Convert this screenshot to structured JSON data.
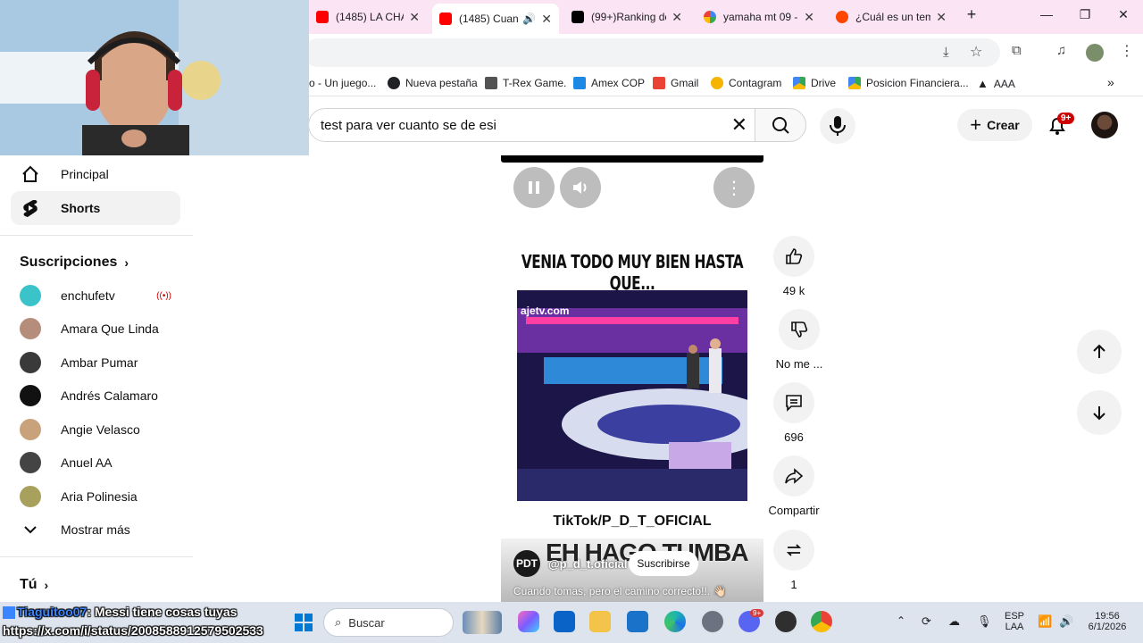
{
  "browser": {
    "tabs": [
      {
        "title": "(1485) LA CHAR",
        "active": false
      },
      {
        "title": "(1485) Cuan",
        "active": true
      },
      {
        "title": "(99+)Ranking de",
        "active": false
      },
      {
        "title": "yamaha mt 09 -",
        "active": false
      },
      {
        "title": "¿Cuál es un tem",
        "active": false
      }
    ],
    "new_tab": "+",
    "bookmarks": [
      {
        "label": "o - Un juego...",
        "color": "#3c7a3c"
      },
      {
        "label": "Nueva pestaña",
        "color": "#202124"
      },
      {
        "label": "T-Rex Game.",
        "color": "#535353"
      },
      {
        "label": "Amex COP",
        "color": "#1e88e5"
      },
      {
        "label": "Gmail",
        "color": "#ea4335"
      },
      {
        "label": "Contagram",
        "color": "#f4b400"
      },
      {
        "label": "Drive",
        "color": "#34a853"
      },
      {
        "label": "Posicion Financiera...",
        "color": "#34a853"
      },
      {
        "label": "AAA",
        "color": "#202124"
      }
    ],
    "more_bookmarks": "»"
  },
  "youtube": {
    "search_query": "test para ver cuanto se de esi",
    "create_label": "Crear",
    "notif_badge": "9+"
  },
  "sidebar": {
    "top_items": [
      {
        "label": "Principal",
        "icon": "home-icon",
        "selected": false
      },
      {
        "label": "Shorts",
        "icon": "shorts-icon",
        "selected": true
      }
    ],
    "subscriptions_heading": "Suscripciones",
    "subscriptions": [
      {
        "label": "enchufetv",
        "color": "#3ac3c9",
        "live": true
      },
      {
        "label": "Amara Que Linda",
        "color": "#b58d7a",
        "live": false
      },
      {
        "label": "Ambar Pumar",
        "color": "#3a3a3a",
        "live": false
      },
      {
        "label": "Andrés Calamaro",
        "color": "#111111",
        "live": false
      },
      {
        "label": "Angie Velasco",
        "color": "#c9a27c",
        "live": false
      },
      {
        "label": "Anuel AA",
        "color": "#444444",
        "live": false
      },
      {
        "label": "Aria Polinesia",
        "color": "#a8a15e",
        "live": false
      }
    ],
    "show_more": "Mostrar más",
    "you_heading": "Tú"
  },
  "short": {
    "title": "VENIA TODO MUY BIEN HASTA QUE...",
    "watermark": "ajetv.com",
    "credit": "TikTok/P_D_T_OFICIAL",
    "big_caption": "EH HAGO TUMBA",
    "channel_avatar": "PDT",
    "channel_name": "@p_d_t.oficial",
    "subscribe_label": "Suscribirse",
    "caption": "Cuando tomas, pero el camino correcto!!. 👋🏻",
    "actions": [
      {
        "name": "like",
        "icon": "thumbs-up-icon",
        "label": "49 k"
      },
      {
        "name": "dislike",
        "icon": "thumbs-down-icon",
        "label": "No me ..."
      },
      {
        "name": "comments",
        "icon": "comment-icon",
        "label": "696"
      },
      {
        "name": "share",
        "icon": "share-icon",
        "label": "Compartir"
      },
      {
        "name": "remix",
        "icon": "remix-icon",
        "label": "1"
      }
    ]
  },
  "stream_overlay": {
    "user": "Tiaguitoo07",
    "message": ": Messi tiene cosas tuyas",
    "link": "https://x.com/i/status/2008588912579502533"
  },
  "taskbar": {
    "search_placeholder": "Buscar",
    "lang_top": "ESP",
    "lang_bottom": "LAA",
    "time": "19:56",
    "date": "6/1/2026",
    "chat_badge": "9+"
  }
}
